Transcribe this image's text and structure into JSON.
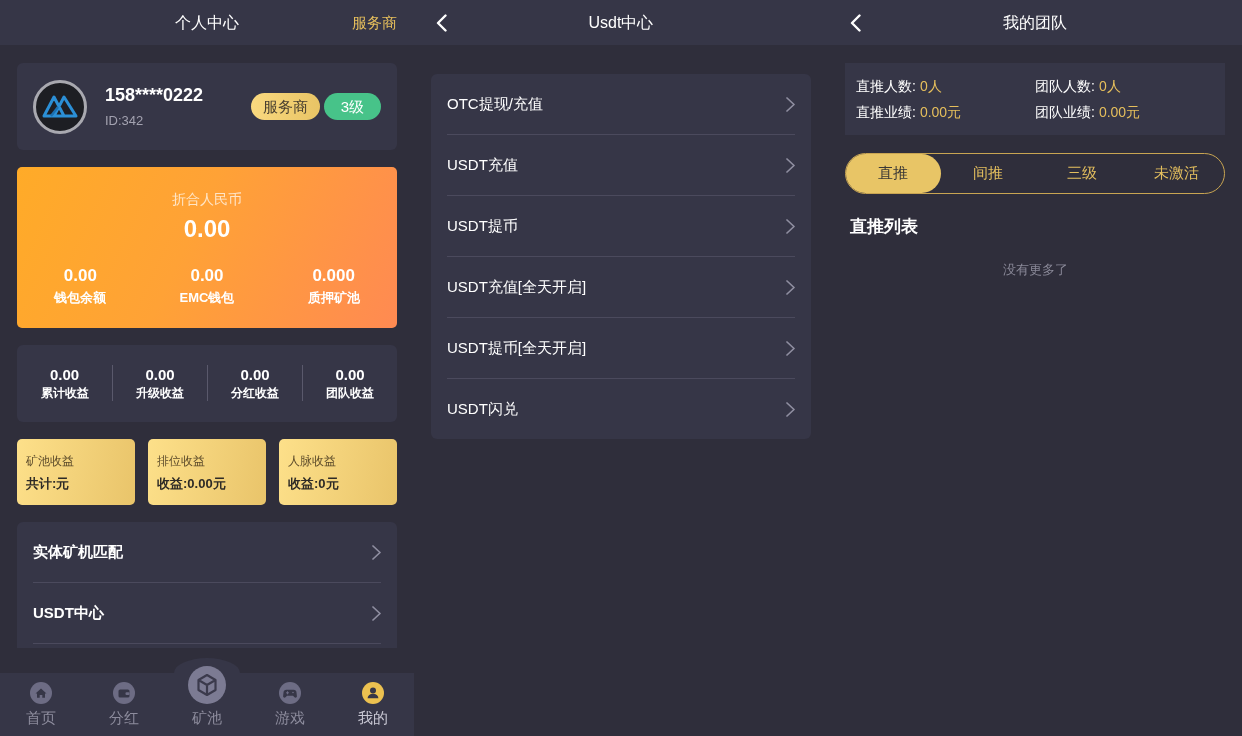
{
  "profile_screen": {
    "header": {
      "title": "个人中心",
      "action": "服务商"
    },
    "user": {
      "phone": "158****0222",
      "id": "ID:342",
      "badges": [
        {
          "kind": "role",
          "label": "服务商"
        },
        {
          "kind": "level",
          "label": "3级"
        }
      ]
    },
    "balance": {
      "label": "折合人民币",
      "value": "0.00",
      "items": [
        {
          "value": "0.00",
          "label": "钱包余额"
        },
        {
          "value": "0.00",
          "label": "EMC钱包"
        },
        {
          "value": "0.000",
          "label": "质押矿池"
        }
      ]
    },
    "earnings": [
      {
        "value": "0.00",
        "label": "累计收益"
      },
      {
        "value": "0.00",
        "label": "升级收益"
      },
      {
        "value": "0.00",
        "label": "分红收益"
      },
      {
        "value": "0.00",
        "label": "团队收益"
      }
    ],
    "income_cards": [
      {
        "title": "矿池收益",
        "value": "共计:元"
      },
      {
        "title": "排位收益",
        "value": "收益:0.00元"
      },
      {
        "title": "人脉收益",
        "value": "收益:0元"
      }
    ],
    "menu": [
      "实体矿机匹配",
      "USDT中心"
    ],
    "tab_bar": [
      {
        "kind": "tab",
        "label": "首页",
        "selected": false
      },
      {
        "kind": "tab",
        "label": "分红",
        "selected": false
      },
      {
        "kind": "raised",
        "label": "矿池",
        "selected": false
      },
      {
        "kind": "tab",
        "label": "游戏",
        "selected": false
      },
      {
        "kind": "tab",
        "label": "我的",
        "selected": true
      }
    ]
  },
  "usdt_screen": {
    "header": {
      "title": "Usdt中心"
    },
    "menu": [
      "OTC提现/充值",
      "USDT充值",
      "USDT提币",
      "USDT充值[全天开启]",
      "USDT提币[全天开启]",
      "USDT闪兑"
    ]
  },
  "team_screen": {
    "header": {
      "title": "我的团队"
    },
    "stats": [
      {
        "label": "直推人数:",
        "value": "0人"
      },
      {
        "label": "团队人数:",
        "value": "0人"
      },
      {
        "label": "直推业绩:",
        "value": "0.00元"
      },
      {
        "label": "团队业绩:",
        "value": "0.00元"
      }
    ],
    "tabs": [
      {
        "label": "直推",
        "selected": true
      },
      {
        "label": "间推",
        "selected": false
      },
      {
        "label": "三级",
        "selected": false
      },
      {
        "label": "未激活",
        "selected": false
      }
    ],
    "list_title": "直推列表",
    "empty_text": "没有更多了"
  }
}
